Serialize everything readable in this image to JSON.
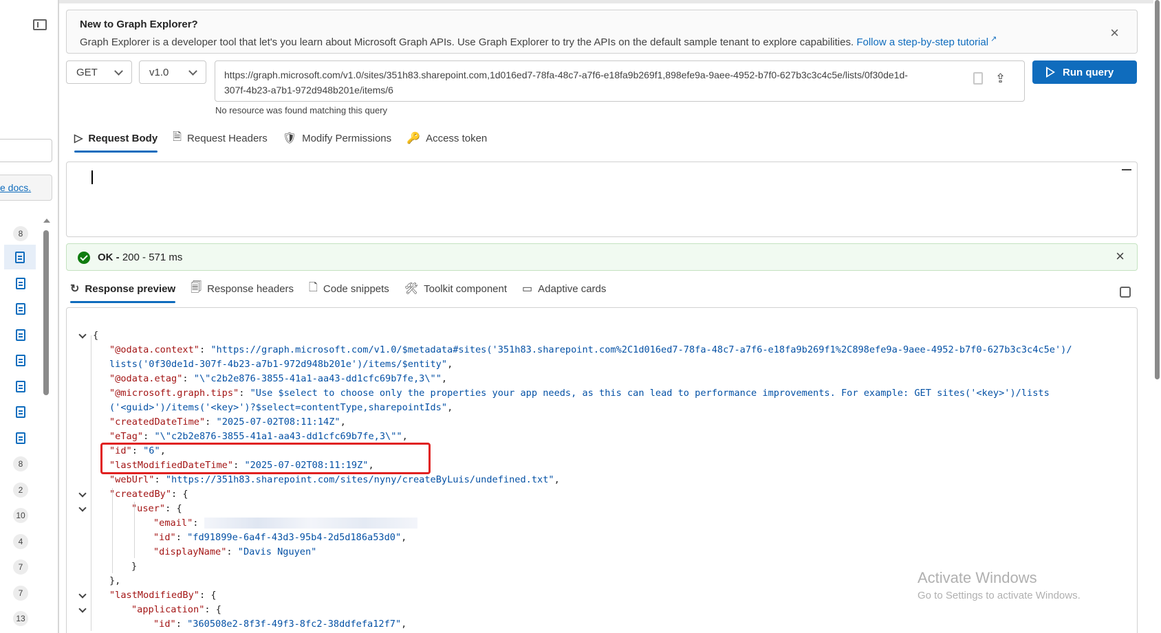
{
  "banner": {
    "title": "New to Graph Explorer?",
    "text": "Graph Explorer is a developer tool that let's you learn about Microsoft Graph APIs. Use Graph Explorer to try the APIs on the default sample tenant to explore capabilities. ",
    "link": "Follow a step-by-step tutorial",
    "close_icon": "×"
  },
  "query": {
    "method": "GET",
    "version": "v1.0",
    "url": "https://graph.microsoft.com/v1.0/sites/351h83.sharepoint.com,1d016ed7-78fa-48c7-a7f6-e18fa9b269f1,898efe9a-9aee-4952-b7f0-627b3c3c4c5e/lists/0f30de1d-307f-4b23-a7b1-972d948b201e/items/6",
    "hint": "No resource was found matching this query",
    "run_label": "Run query"
  },
  "request_tabs": [
    {
      "label": "Request Body",
      "icon": "▷"
    },
    {
      "label": "Request Headers",
      "icon": "🗎"
    },
    {
      "label": "Modify Permissions",
      "icon": "🛡"
    },
    {
      "label": "Access token",
      "icon": "🔑"
    }
  ],
  "status": {
    "ok": "OK -",
    "detail": " 200 - 571 ms",
    "close_icon": "×"
  },
  "response_tabs": [
    {
      "label": "Response preview",
      "icon": "↻"
    },
    {
      "label": "Response headers",
      "icon": "🗐"
    },
    {
      "label": "Code snippets",
      "icon": "🗋"
    },
    {
      "label": "Toolkit component",
      "icon": "🛠"
    },
    {
      "label": "Adaptive cards",
      "icon": "▭"
    }
  ],
  "sidebar": {
    "docs_link": "e docs.",
    "items": [
      {
        "type": "badge",
        "value": "8"
      },
      {
        "type": "doc",
        "value": ""
      },
      {
        "type": "doc",
        "value": ""
      },
      {
        "type": "doc",
        "value": ""
      },
      {
        "type": "doc",
        "value": ""
      },
      {
        "type": "doc",
        "value": ""
      },
      {
        "type": "doc",
        "value": ""
      },
      {
        "type": "doc",
        "value": ""
      },
      {
        "type": "doc",
        "value": ""
      },
      {
        "type": "badge",
        "value": "8"
      },
      {
        "type": "badge",
        "value": "2"
      },
      {
        "type": "badge",
        "value": "10"
      },
      {
        "type": "badge",
        "value": "4"
      },
      {
        "type": "badge",
        "value": "7"
      },
      {
        "type": "badge",
        "value": "7"
      },
      {
        "type": "badge",
        "value": "13"
      }
    ]
  },
  "json_lines": [
    {
      "indent": 0,
      "fold": true,
      "parts": [
        [
          "p",
          "{"
        ]
      ]
    },
    {
      "indent": 1,
      "parts": [
        [
          "k",
          "\"@odata.context\""
        ],
        [
          "p",
          ": "
        ],
        [
          "s",
          "\"https://graph.microsoft.com/v1.0/$metadata#sites('351h83.sharepoint.com%2C1d016ed7-78fa-48c7-a7f6-e18fa9b269f1%2C898efe9a-9aee-4952-b7f0-627b3c3c4c5e')/"
        ]
      ]
    },
    {
      "indent": 1,
      "parts": [
        [
          "s",
          "lists('0f30de1d-307f-4b23-a7b1-972d948b201e')/items/$entity\""
        ],
        [
          "p",
          ","
        ]
      ]
    },
    {
      "indent": 1,
      "parts": [
        [
          "k",
          "\"@odata.etag\""
        ],
        [
          "p",
          ": "
        ],
        [
          "s",
          "\"\\\"c2b2e876-3855-41a1-aa43-dd1cfc69b7fe,3\\\"\""
        ],
        [
          "p",
          ","
        ]
      ]
    },
    {
      "indent": 1,
      "parts": [
        [
          "k",
          "\"@microsoft.graph.tips\""
        ],
        [
          "p",
          ": "
        ],
        [
          "s",
          "\"Use $select to choose only the properties your app needs, as this can lead to performance improvements. For example: GET sites('<key>')/lists"
        ]
      ]
    },
    {
      "indent": 1,
      "parts": [
        [
          "s",
          "('<guid>')/items('<key>')?$select=contentType,sharepointIds\""
        ],
        [
          "p",
          ","
        ]
      ]
    },
    {
      "indent": 1,
      "parts": [
        [
          "k",
          "\"createdDateTime\""
        ],
        [
          "p",
          ": "
        ],
        [
          "s",
          "\"2025-07-02T08:11:14Z\""
        ],
        [
          "p",
          ","
        ]
      ]
    },
    {
      "indent": 1,
      "parts": [
        [
          "k",
          "\"eTag\""
        ],
        [
          "p",
          ": "
        ],
        [
          "s",
          "\"\\\"c2b2e876-3855-41a1-aa43-dd1cfc69b7fe,3\\\"\""
        ],
        [
          "p",
          ","
        ]
      ]
    },
    {
      "indent": 1,
      "parts": [
        [
          "k",
          "\"id\""
        ],
        [
          "p",
          ": "
        ],
        [
          "s",
          "\"6\""
        ],
        [
          "p",
          ","
        ]
      ]
    },
    {
      "indent": 1,
      "parts": [
        [
          "k",
          "\"lastModifiedDateTime\""
        ],
        [
          "p",
          ": "
        ],
        [
          "s",
          "\"2025-07-02T08:11:19Z\""
        ],
        [
          "p",
          ","
        ]
      ]
    },
    {
      "indent": 1,
      "parts": [
        [
          "k",
          "\"webUrl\""
        ],
        [
          "p",
          ": "
        ],
        [
          "s",
          "\"https://351h83.sharepoint.com/sites/nyny/createByLuis/undefined.txt\""
        ],
        [
          "p",
          ","
        ]
      ]
    },
    {
      "indent": 1,
      "fold": true,
      "parts": [
        [
          "k",
          "\"createdBy\""
        ],
        [
          "p",
          ": {"
        ]
      ]
    },
    {
      "indent": 2,
      "fold": true,
      "parts": [
        [
          "k",
          "\"user\""
        ],
        [
          "p",
          ": {"
        ]
      ]
    },
    {
      "indent": 3,
      "blur": true,
      "parts": [
        [
          "k",
          "\"email\""
        ],
        [
          "p",
          ": "
        ]
      ]
    },
    {
      "indent": 3,
      "parts": [
        [
          "k",
          "\"id\""
        ],
        [
          "p",
          ": "
        ],
        [
          "s",
          "\"fd91899e-6a4f-43d3-95b4-2d5d186a53d0\""
        ],
        [
          "p",
          ","
        ]
      ]
    },
    {
      "indent": 3,
      "parts": [
        [
          "k",
          "\"displayName\""
        ],
        [
          "p",
          ": "
        ],
        [
          "s",
          "\"Davis Nguyen\""
        ]
      ]
    },
    {
      "indent": 2,
      "parts": [
        [
          "p",
          "}"
        ]
      ]
    },
    {
      "indent": 1,
      "parts": [
        [
          "p",
          "},"
        ]
      ]
    },
    {
      "indent": 1,
      "fold": true,
      "parts": [
        [
          "k",
          "\"lastModifiedBy\""
        ],
        [
          "p",
          ": {"
        ]
      ]
    },
    {
      "indent": 2,
      "fold": true,
      "parts": [
        [
          "k",
          "\"application\""
        ],
        [
          "p",
          ": {"
        ]
      ]
    },
    {
      "indent": 3,
      "parts": [
        [
          "k",
          "\"id\""
        ],
        [
          "p",
          ": "
        ],
        [
          "s",
          "\"360508e2-8f3f-49f3-8fc2-38ddfefa12f7\""
        ],
        [
          "p",
          ","
        ]
      ]
    }
  ],
  "watermark": {
    "line1": "Activate Windows",
    "line2": "Go to Settings to activate Windows."
  }
}
